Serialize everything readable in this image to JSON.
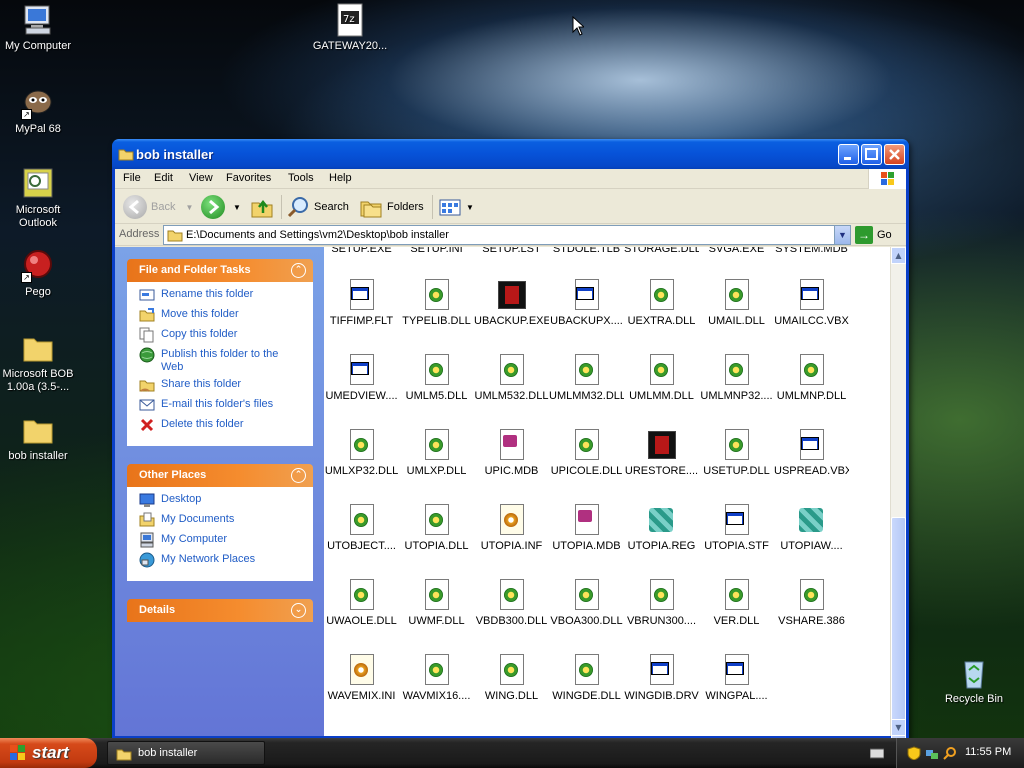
{
  "desktop": {
    "icons": [
      {
        "label": "My Computer"
      },
      {
        "label": "GATEWAY20..."
      },
      {
        "label": "MyPal 68"
      },
      {
        "label": "Microsoft Outlook"
      },
      {
        "label": "Pego"
      },
      {
        "label": "Microsoft BOB 1.00a (3.5-..."
      },
      {
        "label": "bob installer"
      },
      {
        "label": "Recycle Bin"
      }
    ]
  },
  "window": {
    "title": "bob installer",
    "menu": [
      "File",
      "Edit",
      "View",
      "Favorites",
      "Tools",
      "Help"
    ],
    "toolbar": {
      "back": "Back",
      "search": "Search",
      "folders": "Folders"
    },
    "address": {
      "label": "Address",
      "value": "E:\\Documents and Settings\\vm2\\Desktop\\bob installer",
      "go": "Go"
    }
  },
  "taskpane": {
    "file_tasks": {
      "title": "File and Folder Tasks",
      "items": [
        "Rename this folder",
        "Move this folder",
        "Copy this folder",
        "Publish this folder to the Web",
        "Share this folder",
        "E-mail this folder's files",
        "Delete this folder"
      ]
    },
    "other_places": {
      "title": "Other Places",
      "items": [
        "Desktop",
        "My Documents",
        "My Computer",
        "My Network Places"
      ]
    },
    "details": {
      "title": "Details"
    }
  },
  "files": [
    {
      "name": "SETUP.EXE",
      "icon": "none"
    },
    {
      "name": "SETUP.INI",
      "icon": "none"
    },
    {
      "name": "SETUP.LST",
      "icon": "none"
    },
    {
      "name": "STDOLE.TLB",
      "icon": "none"
    },
    {
      "name": "STORAGE.DLL",
      "icon": "none"
    },
    {
      "name": "SVGA.EXE",
      "icon": "none"
    },
    {
      "name": "SYSTEM.MDB",
      "icon": "none"
    },
    {
      "name": "TIFFIMP.FLT",
      "icon": "window"
    },
    {
      "name": "TYPELIB.DLL",
      "icon": "dll"
    },
    {
      "name": "UBACKUP.EXE",
      "icon": "exe-red"
    },
    {
      "name": "UBACKUPX....",
      "icon": "window"
    },
    {
      "name": "UEXTRA.DLL",
      "icon": "dll"
    },
    {
      "name": "UMAIL.DLL",
      "icon": "dll"
    },
    {
      "name": "UMAILCC.VBX",
      "icon": "window"
    },
    {
      "name": "UMEDVIEW....",
      "icon": "window"
    },
    {
      "name": "UMLM5.DLL",
      "icon": "dll"
    },
    {
      "name": "UMLM532.DLL",
      "icon": "dll"
    },
    {
      "name": "UMLMM32.DLL",
      "icon": "dll"
    },
    {
      "name": "UMLMM.DLL",
      "icon": "dll"
    },
    {
      "name": "UMLMNP32....",
      "icon": "dll"
    },
    {
      "name": "UMLMNP.DLL",
      "icon": "dll"
    },
    {
      "name": "UMLXP32.DLL",
      "icon": "dll"
    },
    {
      "name": "UMLXP.DLL",
      "icon": "dll"
    },
    {
      "name": "UPIC.MDB",
      "icon": "mdb"
    },
    {
      "name": "UPICOLE.DLL",
      "icon": "dll"
    },
    {
      "name": "URESTORE....",
      "icon": "exe-red"
    },
    {
      "name": "USETUP.DLL",
      "icon": "dll"
    },
    {
      "name": "USPREAD.VBX",
      "icon": "window"
    },
    {
      "name": "UTOBJECT....",
      "icon": "dll"
    },
    {
      "name": "UTOPIA.DLL",
      "icon": "dll"
    },
    {
      "name": "UTOPIA.INF",
      "icon": "inf"
    },
    {
      "name": "UTOPIA.MDB",
      "icon": "mdb"
    },
    {
      "name": "UTOPIA.REG",
      "icon": "reg"
    },
    {
      "name": "UTOPIA.STF",
      "icon": "window"
    },
    {
      "name": "UTOPIAW....",
      "icon": "reg"
    },
    {
      "name": "UWAOLE.DLL",
      "icon": "dll"
    },
    {
      "name": "UWMF.DLL",
      "icon": "dll"
    },
    {
      "name": "VBDB300.DLL",
      "icon": "dll"
    },
    {
      "name": "VBOA300.DLL",
      "icon": "dll"
    },
    {
      "name": "VBRUN300....",
      "icon": "dll"
    },
    {
      "name": "VER.DLL",
      "icon": "dll"
    },
    {
      "name": "VSHARE.386",
      "icon": "dll"
    },
    {
      "name": "WAVEMIX.INI",
      "icon": "inf"
    },
    {
      "name": "WAVMIX16....",
      "icon": "dll"
    },
    {
      "name": "WING.DLL",
      "icon": "dll"
    },
    {
      "name": "WINGDE.DLL",
      "icon": "dll"
    },
    {
      "name": "WINGDIB.DRV",
      "icon": "window"
    },
    {
      "name": "WINGPAL....",
      "icon": "window"
    }
  ],
  "taskbar": {
    "start": "start",
    "items": [
      {
        "label": "bob installer"
      }
    ],
    "clock": "11:55 PM"
  }
}
